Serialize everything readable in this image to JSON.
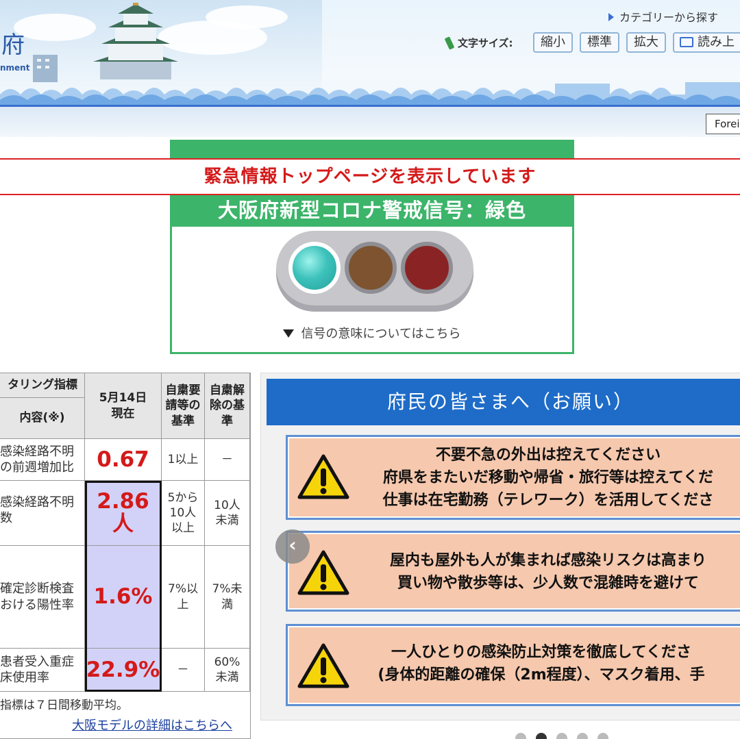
{
  "header": {
    "logo_text": "府",
    "logo_sub": "nment",
    "category_link": "カテゴリーから探す",
    "font_size_label": "文字サイズ:",
    "font_buttons": [
      "縮小",
      "標準",
      "拡大"
    ],
    "read_aloud": "読み上",
    "foreign": "Forei"
  },
  "emergency": {
    "banner": "緊急情報トップページを表示しています"
  },
  "signal": {
    "title": "大阪府新型コロナ警戒信号：緑色",
    "meaning_link": "信号の意味についてはこちら",
    "colors": {
      "green": "#3cb46a",
      "lamp_on": "#3dc2bb",
      "lamp_yellow": "#7d5330",
      "lamp_red": "#8a2424"
    }
  },
  "monitoring": {
    "header_indicator": "タリング指標",
    "header_content": "内容(※)",
    "header_date": "5月14日\n現在",
    "header_request": "自粛要\n請等の\n基準",
    "header_release": "自粛解\n除の基\n準",
    "rows": [
      {
        "content": "感染経路不明\nの前週増加比",
        "value": "0.67",
        "request": "1以上",
        "release": "－"
      },
      {
        "content": "感染経路不明\n数",
        "value": "2.86\n人",
        "request": "5から\n10人\n以上",
        "release": "10人\n未満"
      },
      {
        "content": "確定診断検査\nおける陽性率",
        "value": "1.6%",
        "request": "7%以\n上",
        "release": "7%未\n満"
      },
      {
        "content": "患者受入重症\n床使用率",
        "value": "22.9%",
        "request": "－",
        "release": "60%\n未満"
      }
    ],
    "note": "指標は７日間移動平均。",
    "detail_link": "大阪モデルの詳細はこちらへ"
  },
  "request": {
    "title": "府民の皆さまへ（お願い）",
    "cards": [
      {
        "lines": [
          "不要不急の外出は控えてください",
          "府県をまたいだ移動や帰省・旅行等は控えてくだ",
          "仕事は在宅勤務（テレワーク）を活用してくださ"
        ]
      },
      {
        "lines": [
          "屋内も屋外も人が集まれば感染リスクは高まり",
          "買い物や散歩等は、少人数で混雑時を避けて"
        ]
      },
      {
        "lines": [
          "一人ひとりの感染防止対策を徹底してくださ",
          "(身体的距離の確保（2m程度）、マスク着用、手"
        ]
      }
    ],
    "prev_button": "‹"
  }
}
